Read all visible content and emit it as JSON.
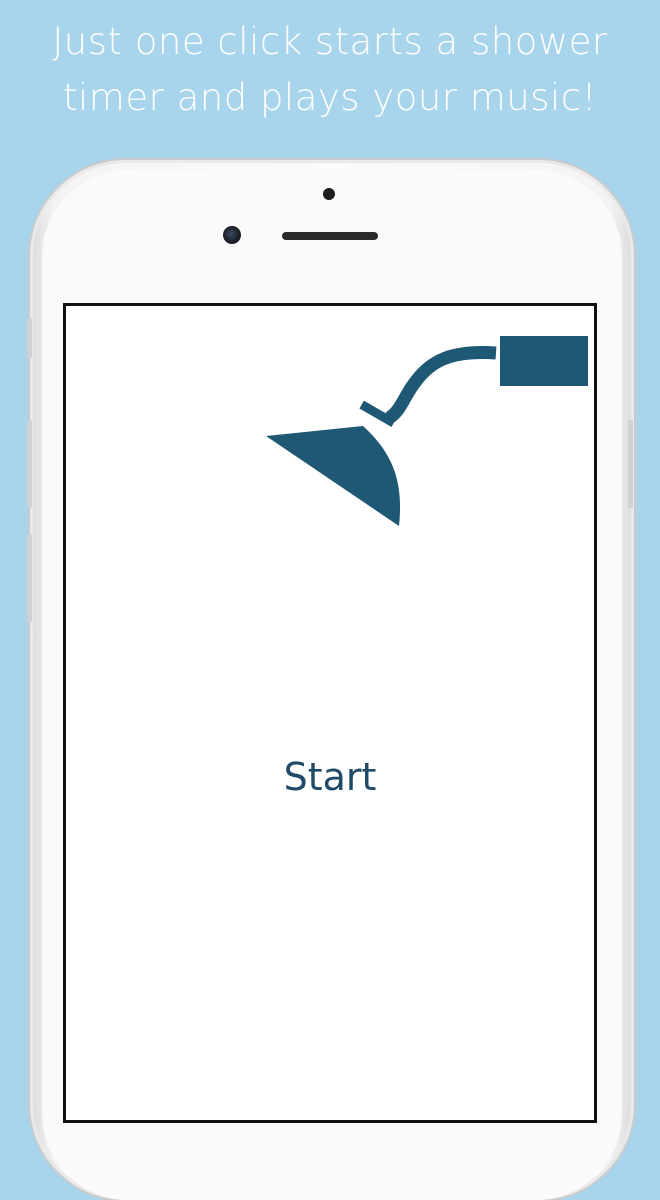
{
  "headline": {
    "line1": "Just one click starts a shower",
    "line2": "timer and plays your music!"
  },
  "app": {
    "start_label": "Start"
  },
  "icons": {
    "shower_head": "shower-head-icon"
  },
  "colors": {
    "background": "#a8d4ec",
    "accent": "#1f5874",
    "text": "#1f4a68"
  }
}
